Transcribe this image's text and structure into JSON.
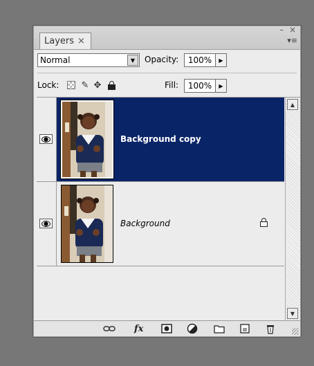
{
  "panel": {
    "tab_label": "Layers",
    "tab_close": "×",
    "window_controls": "– ×",
    "menu_glyph": "▾≡"
  },
  "toolbar": {
    "blend_mode": "Normal",
    "opacity_label": "Opacity:",
    "opacity_value": "100%",
    "lock_label": "Lock:",
    "fill_label": "Fill:",
    "fill_value": "100%"
  },
  "layers": [
    {
      "name": "Background copy",
      "selected": true,
      "visible": true,
      "locked": false
    },
    {
      "name": "Background",
      "selected": false,
      "visible": true,
      "locked": true
    }
  ],
  "icons": {
    "lock_transparent": "checker-icon",
    "lock_image": "brush-icon",
    "lock_position": "move-icon",
    "lock_all": "lock-icon",
    "link": "link-icon",
    "fx": "fx-icon",
    "mask": "mask-icon",
    "adjustment": "adjustment-icon",
    "group": "folder-icon",
    "new_layer": "new-layer-icon",
    "delete": "trash-icon"
  },
  "bottom": {
    "fx_label": "fx"
  },
  "colors": {
    "selection": "#0a2468",
    "panel_bg": "#ececec",
    "desktop_bg": "#777777"
  }
}
